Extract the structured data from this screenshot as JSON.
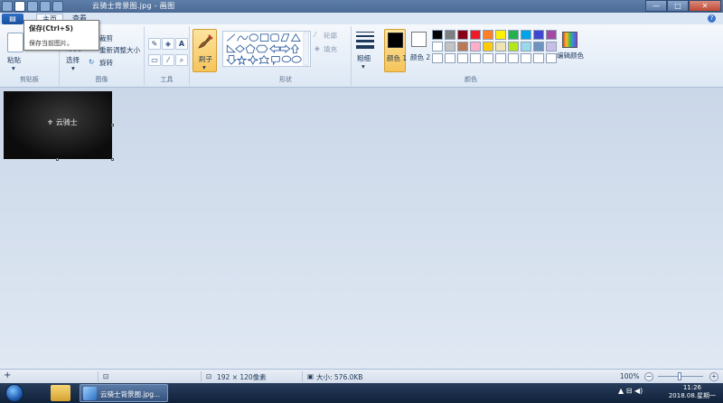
{
  "window": {
    "title": "云骑士背景图.jpg - 画图",
    "minimize": "—",
    "maximize": "□",
    "close": "✕"
  },
  "tabs": {
    "file": "▤",
    "home": "主页",
    "view": "查看",
    "help": "?"
  },
  "tooltip": {
    "title": "保存(Ctrl+S)",
    "desc": "保存当前图片。"
  },
  "ribbon": {
    "clipboard": {
      "label": "剪贴板",
      "paste": "粘贴"
    },
    "image": {
      "label": "图像",
      "select": "选择",
      "crop": "裁剪",
      "resize": "重新调整大小",
      "rotate": "旋转"
    },
    "tools": {
      "label": "工具",
      "text_tool": "A"
    },
    "brushes": {
      "label": "刷子"
    },
    "shapes": {
      "label": "形状",
      "outline": "轮廓",
      "fill": "填充"
    },
    "size": {
      "label": "粗细"
    },
    "colors": {
      "label": "颜色",
      "color1": "颜色 1",
      "color2": "颜色 2",
      "edit": "编辑颜色",
      "color1_value": "#000000",
      "color2_value": "#ffffff",
      "palette": [
        "#000000",
        "#7f7f7f",
        "#880015",
        "#ed1c24",
        "#ff7f27",
        "#fff200",
        "#22b14c",
        "#00a2e8",
        "#3f48cc",
        "#a349a4",
        "#ffffff",
        "#c3c3c3",
        "#b97a57",
        "#ffaec9",
        "#ffc90e",
        "#efe4b0",
        "#b5e61d",
        "#99d9ea",
        "#7092be",
        "#c8bfe7",
        "#ffffff",
        "#ffffff",
        "#ffffff",
        "#ffffff",
        "#ffffff",
        "#ffffff",
        "#ffffff",
        "#ffffff",
        "#ffffff",
        "#ffffff"
      ]
    }
  },
  "canvas": {
    "image_text": "⚜ 云骑士"
  },
  "status": {
    "add": "+",
    "dimensions": "192 × 120像素",
    "size": "大小: 576.0KB",
    "zoom": "100%",
    "zoom_out": "−",
    "zoom_in": "+"
  },
  "taskbar": {
    "task_label": "云骑士背景图.jpg...",
    "tray": "▲  ⊟  ◀)",
    "time": "11:26",
    "date": "2018.08.星期一"
  }
}
